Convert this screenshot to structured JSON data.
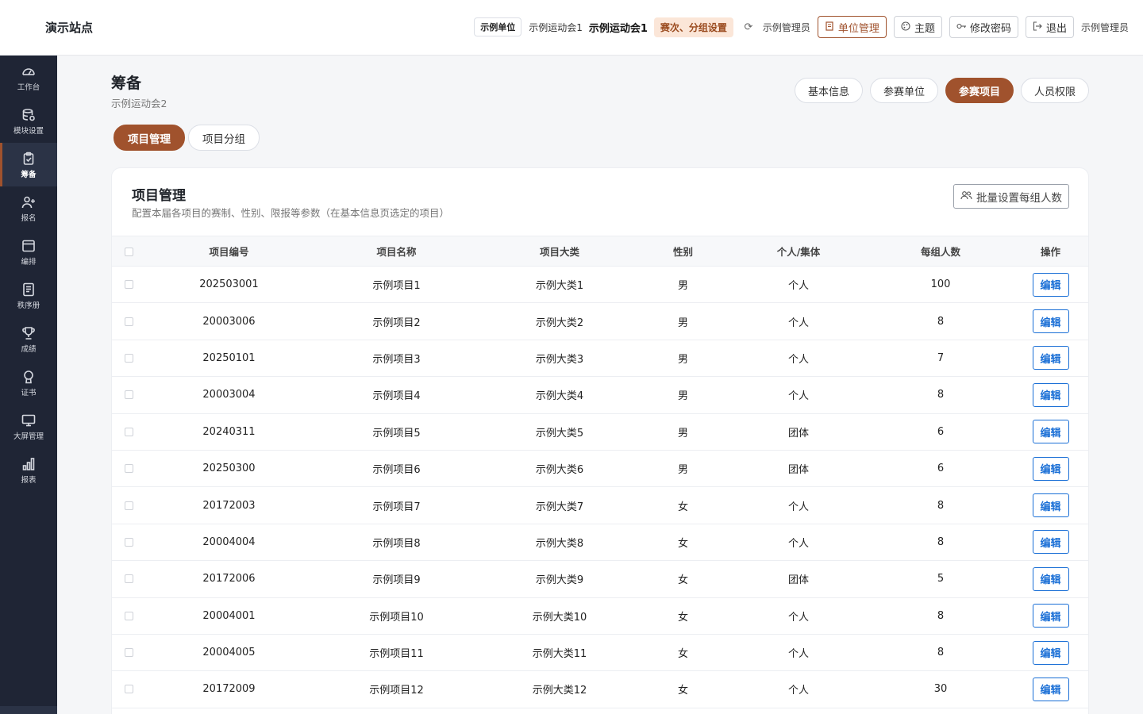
{
  "header": {
    "site_name": "演示站点",
    "unit_tag": "示例单位",
    "meet_small": "示例运动会1",
    "meet_big": "示例运动会1",
    "stage_tag": "赛次、分组设置",
    "refresh_glyph": "⟳",
    "admin_label": "示例管理员",
    "buttons": [
      {
        "label": "单位管理",
        "icon": "building-icon"
      },
      {
        "label": "主题",
        "icon": "palette-icon"
      },
      {
        "label": "修改密码",
        "icon": "key-icon"
      },
      {
        "label": "退出",
        "icon": "logout-icon"
      }
    ],
    "user_name": "示例管理员"
  },
  "sidebar": {
    "items": [
      {
        "label": "工作台",
        "icon": "dashboard-icon"
      },
      {
        "label": "模块设置",
        "icon": "database-icon"
      },
      {
        "label": "筹备",
        "icon": "clipboard-icon",
        "active": true
      },
      {
        "label": "报名",
        "icon": "user-add-icon"
      },
      {
        "label": "编排",
        "icon": "calendar-icon"
      },
      {
        "label": "秩序册",
        "icon": "book-icon"
      },
      {
        "label": "成绩",
        "icon": "trophy-icon"
      },
      {
        "label": "证书",
        "icon": "medal-icon"
      },
      {
        "label": "大屏管理",
        "icon": "monitor-icon"
      },
      {
        "label": "报表",
        "icon": "bar-chart-icon"
      }
    ]
  },
  "page": {
    "title": "筹备",
    "subtitle": "示例运动会2",
    "top_tabs": [
      "基本信息",
      "参赛单位",
      "参赛项目",
      "人员权限"
    ],
    "top_tabs_active": 2,
    "sub_tabs": [
      "项目管理",
      "项目分组"
    ],
    "sub_tabs_active": 0
  },
  "card": {
    "title": "项目管理",
    "description": "配置本届各项目的赛制、性别、限报等参数（在基本信息页选定的项目）",
    "batch_button": "批量设置每组人数"
  },
  "table": {
    "columns": [
      "项目编号",
      "项目名称",
      "项目大类",
      "性别",
      "个人/集体",
      "每组人数",
      "操作"
    ],
    "edit_label": "编辑",
    "rows": [
      [
        "202503001",
        "示例项目1",
        "示例大类1",
        "男",
        "个人",
        "100"
      ],
      [
        "20003006",
        "示例项目2",
        "示例大类2",
        "男",
        "个人",
        "8"
      ],
      [
        "20250101",
        "示例项目3",
        "示例大类3",
        "男",
        "个人",
        "7"
      ],
      [
        "20003004",
        "示例项目4",
        "示例大类4",
        "男",
        "个人",
        "8"
      ],
      [
        "20240311",
        "示例项目5",
        "示例大类5",
        "男",
        "团体",
        "6"
      ],
      [
        "20250300",
        "示例项目6",
        "示例大类6",
        "男",
        "团体",
        "6"
      ],
      [
        "20172003",
        "示例项目7",
        "示例大类7",
        "女",
        "个人",
        "8"
      ],
      [
        "20004004",
        "示例项目8",
        "示例大类8",
        "女",
        "个人",
        "8"
      ],
      [
        "20172006",
        "示例项目9",
        "示例大类9",
        "女",
        "团体",
        "5"
      ],
      [
        "20004001",
        "示例项目10",
        "示例大类10",
        "女",
        "个人",
        "8"
      ],
      [
        "20004005",
        "示例项目11",
        "示例大类11",
        "女",
        "个人",
        "8"
      ],
      [
        "20172009",
        "示例项目12",
        "示例大类12",
        "女",
        "个人",
        "30"
      ]
    ]
  },
  "colors": {
    "accent": "#a0522d",
    "sidebar_bg": "#1f2535",
    "edit_blue": "#1a6fd6"
  }
}
